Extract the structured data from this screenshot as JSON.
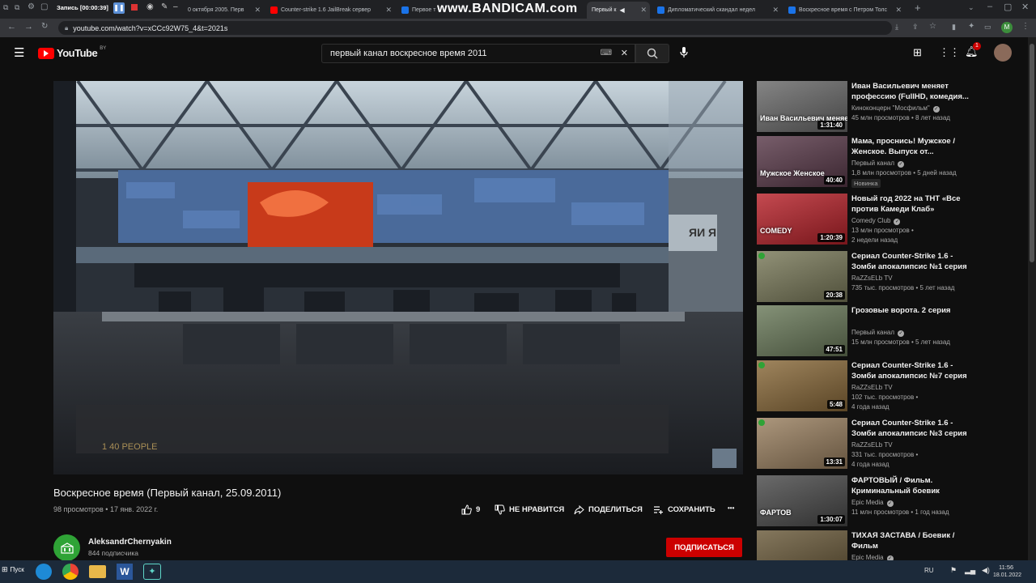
{
  "recorder": {
    "label": "Запись [00:00:39]",
    "watermark": "www.BANDICAM.com"
  },
  "tabs": [
    {
      "label": "0 октября 2005. Перв",
      "color": "#1a73e8"
    },
    {
      "label": "Counter-strike 1.6 JailBreak сервер",
      "color": "#ff0000"
    },
    {
      "label": "Первое т",
      "color": "#1a73e8"
    },
    {
      "label": "Первый к",
      "color": "#1a73e8"
    },
    {
      "label": "Дипломатический скандал недел",
      "color": "#1a73e8"
    },
    {
      "label": "Воскресное время с Петром Толс",
      "color": "#1a73e8"
    }
  ],
  "address": {
    "url": "youtube.com/watch?v=xCCc92W75_4&t=2021s"
  },
  "youtube": {
    "logo": "YouTube",
    "region": "BY",
    "search_value": "первый канал воскресное время 2011",
    "notifications": "1",
    "avatar_letter": "M"
  },
  "video": {
    "title": "Воскресное время (Первый канал, 25.09.2011)",
    "meta": "98 просмотров • 17 янв. 2022 г.",
    "likes": "9",
    "dislike_label": "НЕ НРАВИТСЯ",
    "share_label": "ПОДЕЛИТЬСЯ",
    "save_label": "СОХРАНИТЬ",
    "more_label": "•••",
    "on_screen_text": "1 40 PEOPLE"
  },
  "channel": {
    "name": "AleksandrChernyakin",
    "subs": "844 подписчика",
    "subscribe_label": "ПОДПИСАТЬСЯ"
  },
  "recommendations": [
    {
      "title": "Иван Васильевич меняет профессию (FullHD, комедия...",
      "channel": "Киноконцерн \"Мосфильм\"",
      "views": "45 млн просмотров • 8 лет назад",
      "extra": "",
      "duration": "1:31:40",
      "thumb_text": "Иван Васильевич меняет профе",
      "thumb_color": "#6a6a6a",
      "verified": true,
      "live": false,
      "is_new": false
    },
    {
      "title": "Мама, проснись! Мужское / Женское. Выпуск от...",
      "channel": "Первый канал",
      "views": "1,8 млн просмотров • 5 дней назад",
      "extra": "Новинка",
      "duration": "40:40",
      "thumb_text": "Мужское Женское",
      "thumb_color": "#5a3a4a",
      "verified": true,
      "live": false,
      "is_new": true
    },
    {
      "title": "Новый год 2022 на ТНТ «Все против Камеди Клаб»",
      "channel": "Comedy Club",
      "views": "13 млн просмотров •",
      "extra": "2 недели назад",
      "duration": "1:20:39",
      "thumb_text": "COMEDY",
      "thumb_color": "#b8222a",
      "verified": true,
      "live": false,
      "is_new": false
    },
    {
      "title": "Сериал Counter-Strike 1.6 - Зомби апокалипсис №1 серия",
      "channel": "RaZZsELb TV",
      "views": "735 тыс. просмотров • 5 лет назад",
      "extra": "",
      "duration": "20:38",
      "thumb_text": "",
      "thumb_color": "#7a7a5a",
      "verified": false,
      "live": true,
      "is_new": false
    },
    {
      "title": "Грозовые ворота. 2 серия",
      "channel": "Первый канал",
      "views": "15 млн просмотров • 5 лет назад",
      "extra": "",
      "duration": "47:51",
      "thumb_text": "",
      "thumb_color": "#6a7a5a",
      "verified": true,
      "live": false,
      "is_new": false
    },
    {
      "title": "Сериал Counter-Strike 1.6 - Зомби апокалипсис №7 серия",
      "channel": "RaZZsELb TV",
      "views": "102 тыс. просмотров •",
      "extra": "4 года назад",
      "duration": "5:48",
      "thumb_text": "",
      "thumb_color": "#8a6a3a",
      "verified": false,
      "live": true,
      "is_new": false
    },
    {
      "title": "Сериал Counter-Strike 1.6 - Зомби апокалипсис №3 серия",
      "channel": "RaZZsELb TV",
      "views": "331 тыс. просмотров •",
      "extra": "4 года назад",
      "duration": "13:31",
      "thumb_text": "",
      "thumb_color": "#9a8060",
      "verified": false,
      "live": true,
      "is_new": false
    },
    {
      "title": "ФАРТОВЫЙ / Фильм. Криминальный боевик",
      "channel": "Epic Media",
      "views": "11 млн просмотров • 1 год назад",
      "extra": "",
      "duration": "1:30:07",
      "thumb_text": "ФАРТОВ",
      "thumb_color": "#4a4a4a",
      "verified": true,
      "live": false,
      "is_new": false
    },
    {
      "title": "ТИХАЯ ЗАСТАВА / Боевик / Фильм",
      "channel": "Epic Media",
      "views": "",
      "extra": "",
      "duration": "",
      "thumb_text": "",
      "thumb_color": "#6a5a3a",
      "verified": true,
      "live": false,
      "is_new": false
    }
  ],
  "taskbar": {
    "start_label": "Пуск",
    "lang": "RU",
    "time": "11:56",
    "date": "18.01.2022"
  },
  "colors": {
    "accent_red": "#cc0000",
    "bg": "#0f0f0f",
    "channel_green": "#2fa336"
  }
}
